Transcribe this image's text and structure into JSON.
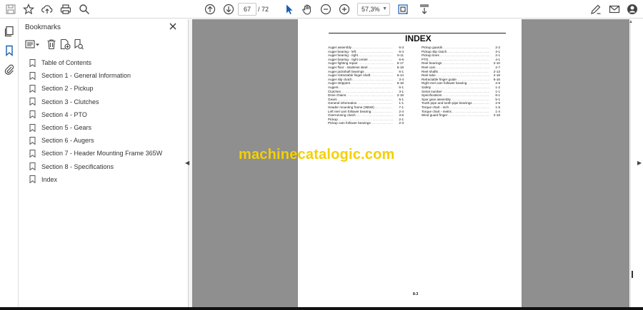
{
  "toolbar": {
    "current_page": "67",
    "total_pages": "/ 72",
    "zoom": "57,3%"
  },
  "bookmarks": {
    "title": "Bookmarks",
    "items": [
      {
        "label": "Table of Contents"
      },
      {
        "label": "Section 1 - General Information"
      },
      {
        "label": "Section 2 - Pickup"
      },
      {
        "label": "Section 3 - Clutches"
      },
      {
        "label": "Section 4 - PTO"
      },
      {
        "label": "Section 5 - Gears"
      },
      {
        "label": "Section 6 - Augers"
      },
      {
        "label": "Section 7 - Header Mounting Frame 365W"
      },
      {
        "label": "Section 8 - Specifications"
      },
      {
        "label": "Index"
      }
    ]
  },
  "document": {
    "title": "INDEX",
    "footer_page": "8-3",
    "left_column": [
      {
        "term": "Auger assembly",
        "page": "6-3"
      },
      {
        "term": "Auger bearing - left",
        "page": "6-4"
      },
      {
        "term": "Auger bearing - right",
        "page": "6-11"
      },
      {
        "term": "Auger bearing - right center",
        "page": "6-6"
      },
      {
        "term": "Auger fighting repair",
        "page": "6-17"
      },
      {
        "term": "Auger floor - stainless steel",
        "page": "6-19"
      },
      {
        "term": "Auger jackshaft bearings",
        "page": "6-1"
      },
      {
        "term": "Auger retractable finger shaft",
        "page": "6-14"
      },
      {
        "term": "Auger slip clutch",
        "page": "3-4"
      },
      {
        "term": "Auger strippers",
        "page": "6-18"
      },
      {
        "term": "Augers",
        "page": "6-1"
      },
      {
        "term": "Clutches",
        "page": "3-1"
      },
      {
        "term": "Drive chains",
        "page": "2-18"
      },
      {
        "term": "Gears",
        "page": "5-1"
      },
      {
        "term": "General information",
        "page": "1-1"
      },
      {
        "term": "Header mounting frame (365W)",
        "page": "7-1"
      },
      {
        "term": "Left reel cam follower bearing",
        "page": "2-4"
      },
      {
        "term": "Overrunning clutch",
        "page": "3-6"
      },
      {
        "term": "Pickup",
        "page": "2-1"
      },
      {
        "term": "Pickup cam follower bearings",
        "page": "2-3"
      }
    ],
    "right_column": [
      {
        "term": "Pickup guards",
        "page": "2-2"
      },
      {
        "term": "Pickup slip clutch",
        "page": "3-1"
      },
      {
        "term": "Pickup tines",
        "page": "2-1"
      },
      {
        "term": "PTO",
        "page": "4-1"
      },
      {
        "term": "Reel bearings",
        "page": "2-10"
      },
      {
        "term": "Reel cam",
        "page": "2-7"
      },
      {
        "term": "Reel shafts",
        "page": "2-13"
      },
      {
        "term": "Reel tube",
        "page": "2-18"
      },
      {
        "term": "Retractable finger guide",
        "page": "6-16"
      },
      {
        "term": "Right reel cam follower bearing",
        "page": "2-6"
      },
      {
        "term": "Safety",
        "page": "1-2"
      },
      {
        "term": "Serial number",
        "page": "1-1"
      },
      {
        "term": "Specifications",
        "page": "8-1"
      },
      {
        "term": "Spur gear assembly",
        "page": "5-1"
      },
      {
        "term": "Tooth pipe and tooth pipe bearings",
        "page": "2-9"
      },
      {
        "term": "Torque chart - inch",
        "page": "1-5"
      },
      {
        "term": "Torque chart - metric",
        "page": "1-4"
      },
      {
        "term": "Wind guard finger",
        "page": "2-18"
      }
    ]
  },
  "watermark": "machinecatalogic.com",
  "icons": {
    "save": "save-icon",
    "star": "star-icon",
    "upload": "cloud-upload-icon",
    "print": "print-icon",
    "search": "search-icon",
    "prev": "arrow-up-circle-icon",
    "next": "arrow-down-circle-icon",
    "select": "cursor-icon",
    "hand": "hand-icon",
    "zoom_out": "zoom-out-icon",
    "zoom_in": "zoom-in-icon",
    "fit": "fit-page-icon",
    "scroll": "scroll-mode-icon",
    "sign": "sign-icon",
    "email": "email-icon",
    "account": "account-icon",
    "bookmark": "bookmark-icon"
  }
}
